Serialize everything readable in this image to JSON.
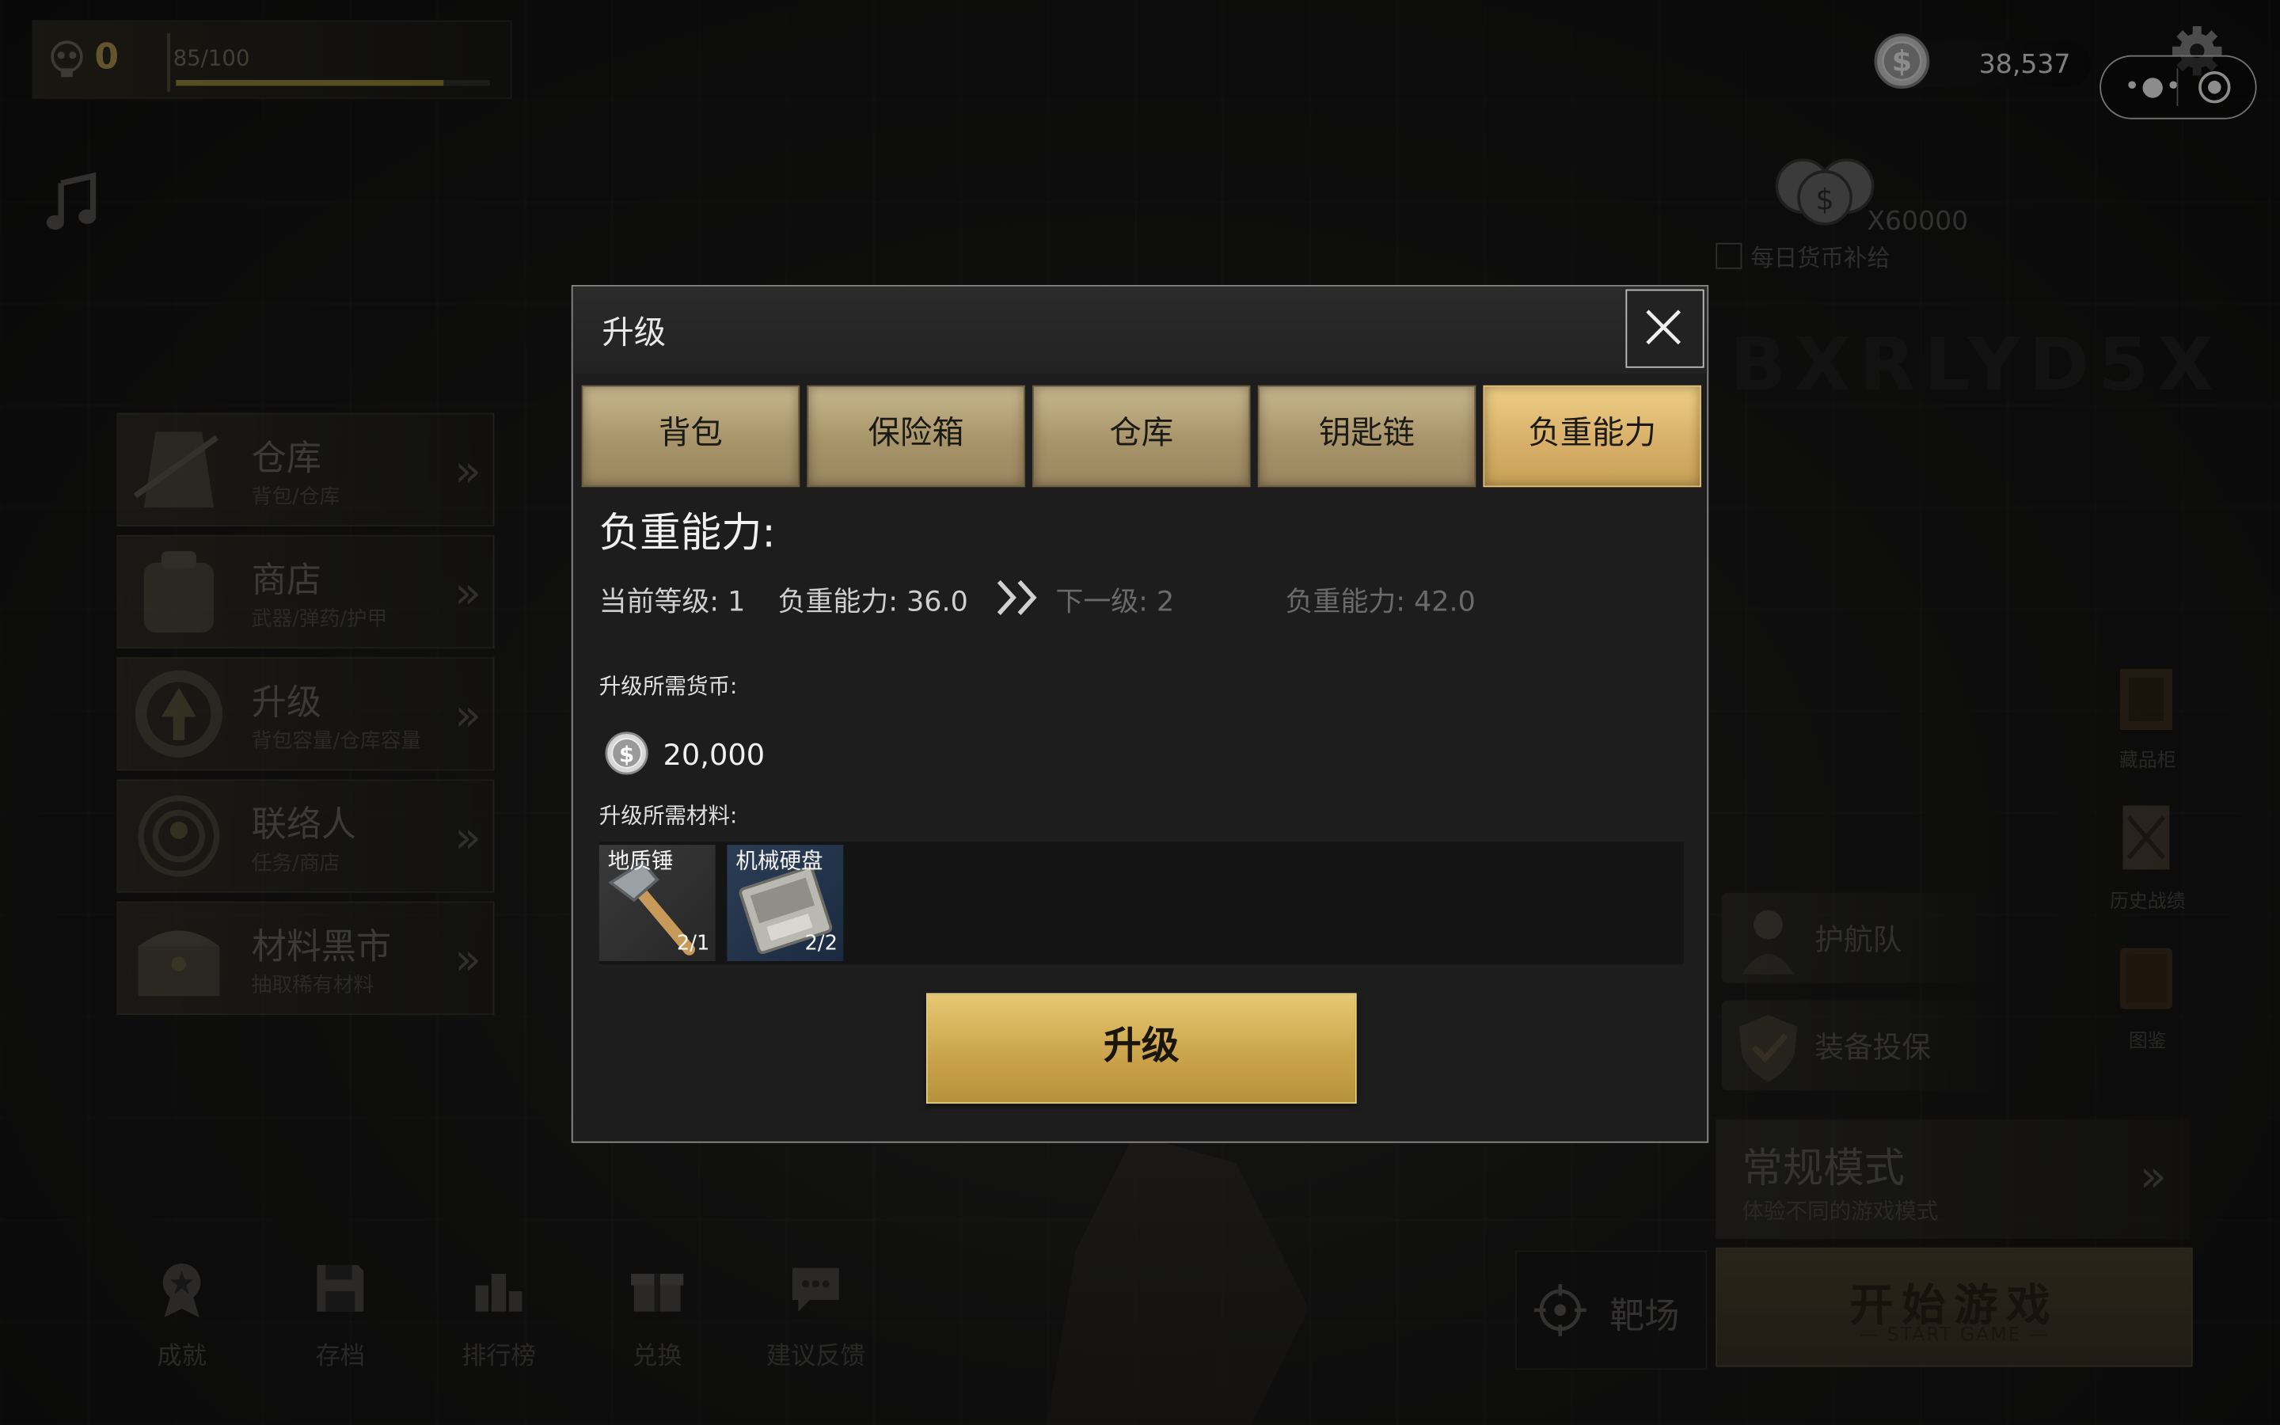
{
  "hud": {
    "level": "0",
    "xp": "85/100",
    "xp_progress": 0.85,
    "coins": "38,537",
    "daily_reward": {
      "amount": "X60000",
      "label": "每日货币补给"
    }
  },
  "left_menu": [
    {
      "title": "仓库",
      "subtitle": "背包/仓库"
    },
    {
      "title": "商店",
      "subtitle": "武器/弹药/护甲"
    },
    {
      "title": "升级",
      "subtitle": "背包容量/仓库容量"
    },
    {
      "title": "联络人",
      "subtitle": "任务/商店"
    },
    {
      "title": "材料黑市",
      "subtitle": "抽取稀有材料"
    }
  ],
  "right_side": {
    "collection": "藏品柜",
    "history": "历史战绩",
    "codex": "图鉴",
    "escort": "护航队",
    "insurance": "装备投保"
  },
  "mode_card": {
    "title": "常规模式",
    "subtitle": "体验不同的游戏模式"
  },
  "range_label": "靶场",
  "start_button": {
    "title": "开始游戏",
    "subtitle": "— START GAME —"
  },
  "watermark": "BXRLYD5X",
  "bottom_nav": [
    "成就",
    "存档",
    "排行榜",
    "兑换",
    "建议反馈"
  ],
  "modal": {
    "title": "升级",
    "tabs": [
      "背包",
      "保险箱",
      "仓库",
      "钥匙链",
      "负重能力"
    ],
    "active_tab": 4,
    "section_title": "负重能力:",
    "current_level": "当前等级: 1",
    "current_capacity": "负重能力: 36.0",
    "next_level": "下一级: 2",
    "next_capacity": "负重能力: 42.0",
    "currency_label": "升级所需货币:",
    "currency_amount": "20,000",
    "materials_label": "升级所需材料:",
    "materials": [
      {
        "name": "地质锤",
        "count": "2/1"
      },
      {
        "name": "机械硬盘",
        "count": "2/2"
      }
    ],
    "upgrade_button": "升级"
  }
}
